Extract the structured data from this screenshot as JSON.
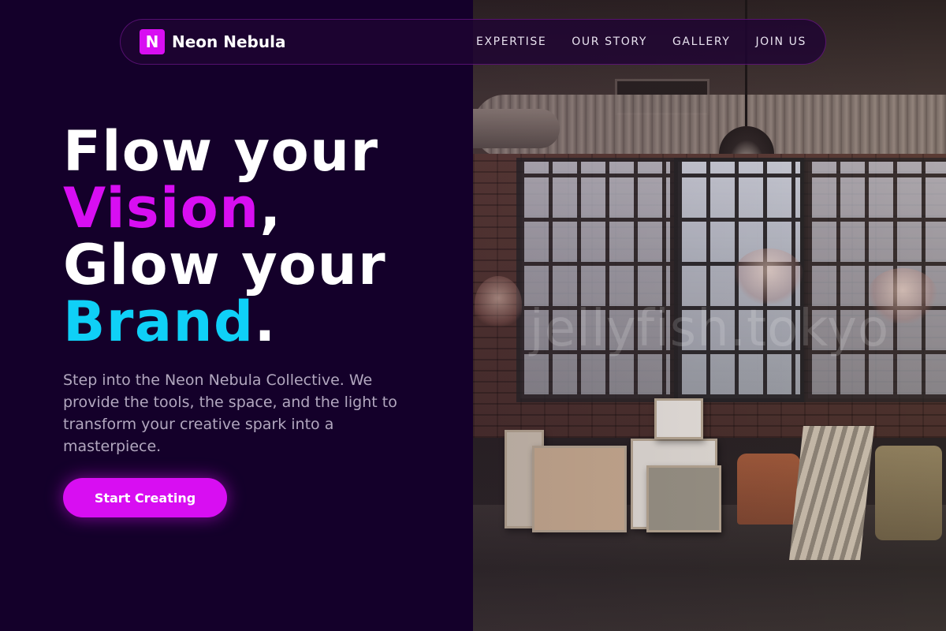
{
  "brand": {
    "mark": "N",
    "name": "Neon Nebula"
  },
  "nav": {
    "links": [
      "EXPERTISE",
      "OUR STORY",
      "GALLERY",
      "JOIN US"
    ]
  },
  "hero": {
    "line1": "Flow your",
    "accent1": "Vision",
    "punct1": ",",
    "line3": "Glow your",
    "accent2": "Brand",
    "punct2": ".",
    "body": "Step into the Neon Nebula Collective. We provide the tools, the space, and the light to transform your creative spark into a masterpiece.",
    "cta": "Start Creating"
  },
  "image": {
    "watermark": "jellyfish.tokyo",
    "subject": "industrial art studio with windows, chandeliers and stacked canvases"
  },
  "colors": {
    "background": "#14002a",
    "accent_magenta": "#d80ef2",
    "accent_cyan": "#0fd0f7",
    "body_text": "#b2a7bf"
  }
}
